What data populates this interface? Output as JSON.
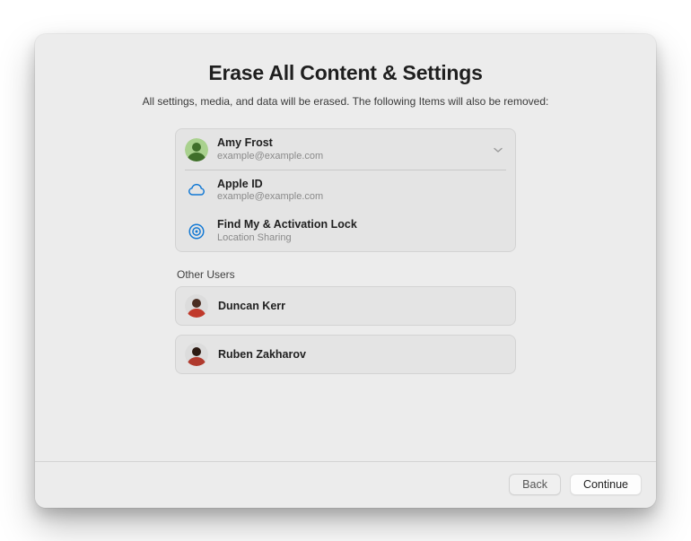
{
  "title": "Erase All Content & Settings",
  "subtitle": "All settings, media, and data will be erased. The following Items will also be removed:",
  "primary_user": {
    "name": "Amy Frost",
    "email": "example@example.com",
    "avatar_colors": [
      "#a9d18e",
      "#3f6f2a"
    ]
  },
  "sub_items": [
    {
      "icon": "icloud",
      "title": "Apple ID",
      "subtitle": "example@example.com"
    },
    {
      "icon": "findmy",
      "title": "Find My & Activation Lock",
      "subtitle": "Location Sharing"
    }
  ],
  "other_users_label": "Other Users",
  "other_users": [
    {
      "name": "Duncan Kerr",
      "avatar_colors": [
        "#c0392b",
        "#4a2d22"
      ]
    },
    {
      "name": "Ruben Zakharov",
      "avatar_colors": [
        "#b03a2e",
        "#2c1a12"
      ]
    }
  ],
  "buttons": {
    "back": "Back",
    "continue": "Continue"
  },
  "icon_color": "#1178d4"
}
